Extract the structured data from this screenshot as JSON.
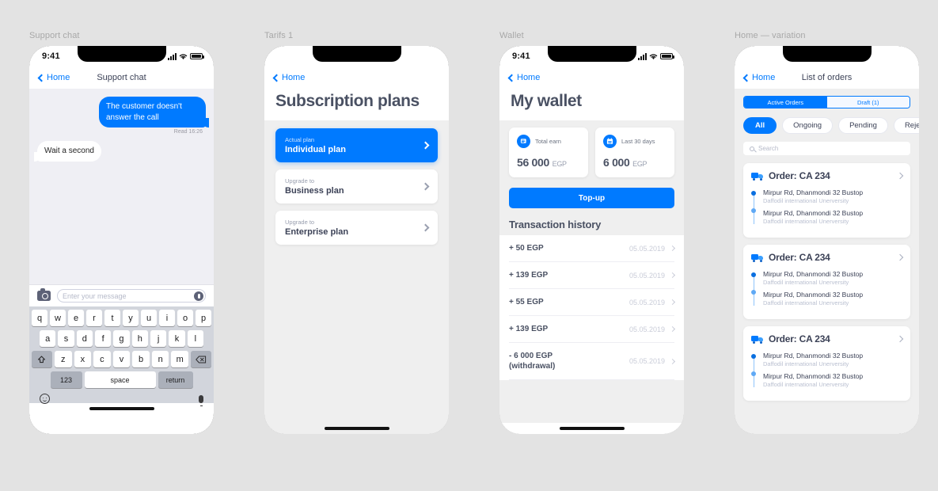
{
  "artboards": [
    {
      "label": "Support chat"
    },
    {
      "label": "Tarifs 1"
    },
    {
      "label": "Wallet"
    },
    {
      "label": "Home — variation"
    }
  ],
  "colors": {
    "accent": "#007aff",
    "page_bg": "#e3e3e3",
    "screen_bg": "#efefef",
    "heading": "#4a5163",
    "muted": "#b6bac9"
  },
  "statusbar": {
    "time": "9:41"
  },
  "chat": {
    "back_label": "Home",
    "title": "Support chat",
    "messages": [
      {
        "text": "The customer doesn't answer the call",
        "side": "out"
      },
      {
        "text": "Wait a second",
        "side": "in"
      }
    ],
    "read_receipt": "Read 16:26",
    "input_placeholder": "Enter your message",
    "keyboard": {
      "row1": [
        "q",
        "w",
        "e",
        "r",
        "t",
        "y",
        "u",
        "i",
        "o",
        "p"
      ],
      "row2": [
        "a",
        "s",
        "d",
        "f",
        "g",
        "h",
        "j",
        "k",
        "l"
      ],
      "row3": [
        "z",
        "x",
        "c",
        "v",
        "b",
        "n",
        "m"
      ],
      "numeric_key": "123",
      "space_key": "space",
      "return_key": "return"
    }
  },
  "plans": {
    "back_label": "Home",
    "title": "Subscription plans",
    "items": [
      {
        "sub": "Actual plan",
        "name": "Individual plan",
        "active": true
      },
      {
        "sub": "Upgrade to",
        "name": "Business plan",
        "active": false
      },
      {
        "sub": "Upgrade to",
        "name": "Enterprise plan",
        "active": false
      }
    ]
  },
  "wallet": {
    "back_label": "Home",
    "title": "My wallet",
    "stats": [
      {
        "label": "Total earn",
        "value": "56 000",
        "currency": "EGP",
        "icon": "money-stack-icon"
      },
      {
        "label": "Last 30 days",
        "value": "6 000",
        "currency": "EGP",
        "icon": "calendar-icon"
      }
    ],
    "topup_label": "Top-up",
    "history_title": "Transaction history",
    "transactions": [
      {
        "amount": "+ 50 EGP",
        "date": "05.05.2019"
      },
      {
        "amount": "+ 139 EGP",
        "date": "05.05.2019"
      },
      {
        "amount": "+ 55 EGP",
        "date": "05.05.2019"
      },
      {
        "amount": "+ 139 EGP",
        "date": "05.05.2019"
      },
      {
        "amount": "- 6 000 EGP\n(withdrawal)",
        "date": "05.05.2019"
      }
    ]
  },
  "orders": {
    "back_label": "Home",
    "title": "List of orders",
    "segments": [
      {
        "label": "Active Orders",
        "selected": true
      },
      {
        "label": "Draft (1)",
        "selected": false
      }
    ],
    "filters": [
      {
        "label": "All",
        "selected": true
      },
      {
        "label": "Ongoing",
        "selected": false
      },
      {
        "label": "Pending",
        "selected": false
      },
      {
        "label": "Rejected",
        "selected": false
      }
    ],
    "search_placeholder": "Search",
    "cards": [
      {
        "title": "Order:  CA 234",
        "stops": [
          {
            "name": "Mirpur Rd, Dhanmondi 32 Bustop",
            "detail": "Daffodil international Unerversity"
          },
          {
            "name": "Mirpur Rd, Dhanmondi 32 Bustop",
            "detail": "Daffodil international Unerversity"
          }
        ]
      },
      {
        "title": "Order:  CA 234",
        "stops": [
          {
            "name": "Mirpur Rd, Dhanmondi 32 Bustop",
            "detail": "Daffodil international Unerversity"
          },
          {
            "name": "Mirpur Rd, Dhanmondi 32 Bustop",
            "detail": "Daffodil international Unerversity"
          }
        ]
      },
      {
        "title": "Order:  CA 234",
        "stops": [
          {
            "name": "Mirpur Rd, Dhanmondi 32 Bustop",
            "detail": "Daffodil international Unerversity"
          },
          {
            "name": "Mirpur Rd, Dhanmondi 32 Bustop",
            "detail": "Daffodil international Unerversity"
          }
        ]
      }
    ]
  }
}
